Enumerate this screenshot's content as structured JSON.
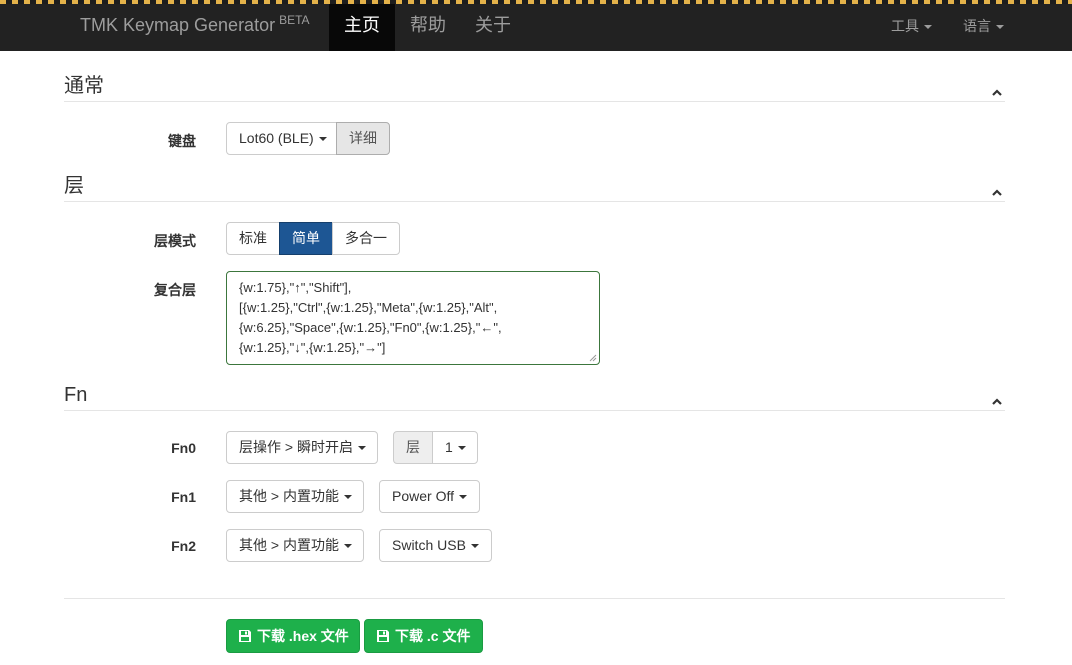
{
  "navbar": {
    "brand": "TMK Keymap Generator",
    "brand_badge": "BETA",
    "items": [
      {
        "label": "主页",
        "active": true
      },
      {
        "label": "帮助",
        "active": false
      },
      {
        "label": "关于",
        "active": false
      }
    ],
    "tools_label": "工具",
    "language_label": "语言"
  },
  "sections": {
    "general": "通常",
    "layers": "层",
    "fn": "Fn"
  },
  "keyboard": {
    "label": "键盘",
    "selected": "Lot60 (BLE)",
    "details_button": "详细"
  },
  "layer_mode": {
    "label": "层模式",
    "options": [
      "标准",
      "简单",
      "多合一"
    ],
    "selected": "简单"
  },
  "composite_layer": {
    "label": "复合层",
    "lines": [
      "{w:1.75},\"↑\",\"Shift\"],",
      "[{w:1.25},\"Ctrl\",{w:1.25},\"Meta\",{w:1.25},\"Alt\",",
      "{w:6.25},\"Space\",{w:1.25},\"Fn0\",{w:1.25},\"←\",",
      "{w:1.25},\"↓\",{w:1.25},\"→\"]"
    ]
  },
  "fn_rows": [
    {
      "label": "Fn0",
      "action": "层操作 > 瞬时开启",
      "param_addon": "层",
      "param": "1"
    },
    {
      "label": "Fn1",
      "action": "其他 > 内置功能",
      "param": "Power Off"
    },
    {
      "label": "Fn2",
      "action": "其他 > 内置功能",
      "param": "Switch USB"
    }
  ],
  "downloads": {
    "hex_label": "下载 .hex 文件",
    "c_label": "下载 .c 文件"
  },
  "colors": {
    "navbar": "#222222",
    "primary": "#1d5694",
    "success": "#1eb04b",
    "valid_border": "#3c763d"
  }
}
